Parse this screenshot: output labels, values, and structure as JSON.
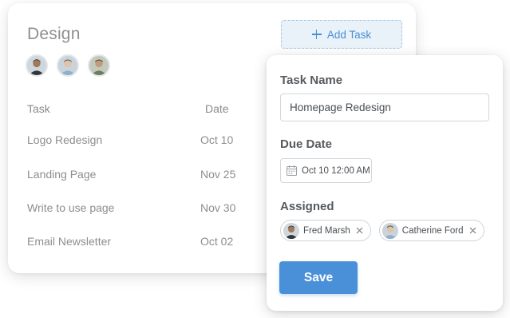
{
  "list": {
    "title": "Design",
    "add_task_label": "Add Task",
    "columns": {
      "task": "Task",
      "date": "Date"
    },
    "rows": [
      {
        "task": "Logo Redesign",
        "date": "Oct 10"
      },
      {
        "task": "Landing Page",
        "date": "Nov 25"
      },
      {
        "task": "Write to use page",
        "date": "Nov 30"
      },
      {
        "task": "Email Newsletter",
        "date": "Oct 02"
      }
    ]
  },
  "form": {
    "task_name_label": "Task Name",
    "task_name_value": "Homepage Redesign",
    "due_date_label": "Due Date",
    "due_date_value": "Oct 10 12:00 AM",
    "assigned_label": "Assigned",
    "assignees": [
      {
        "name": "Fred Marsh"
      },
      {
        "name": "Catherine Ford"
      }
    ],
    "save_label": "Save"
  },
  "colors": {
    "accent": "#4a90d9",
    "add_task_bg": "#e9f1f9",
    "muted_text": "#8e8e8e"
  },
  "icons": {
    "add": "plus-icon",
    "calendar": "calendar-icon",
    "remove": "close-icon"
  }
}
